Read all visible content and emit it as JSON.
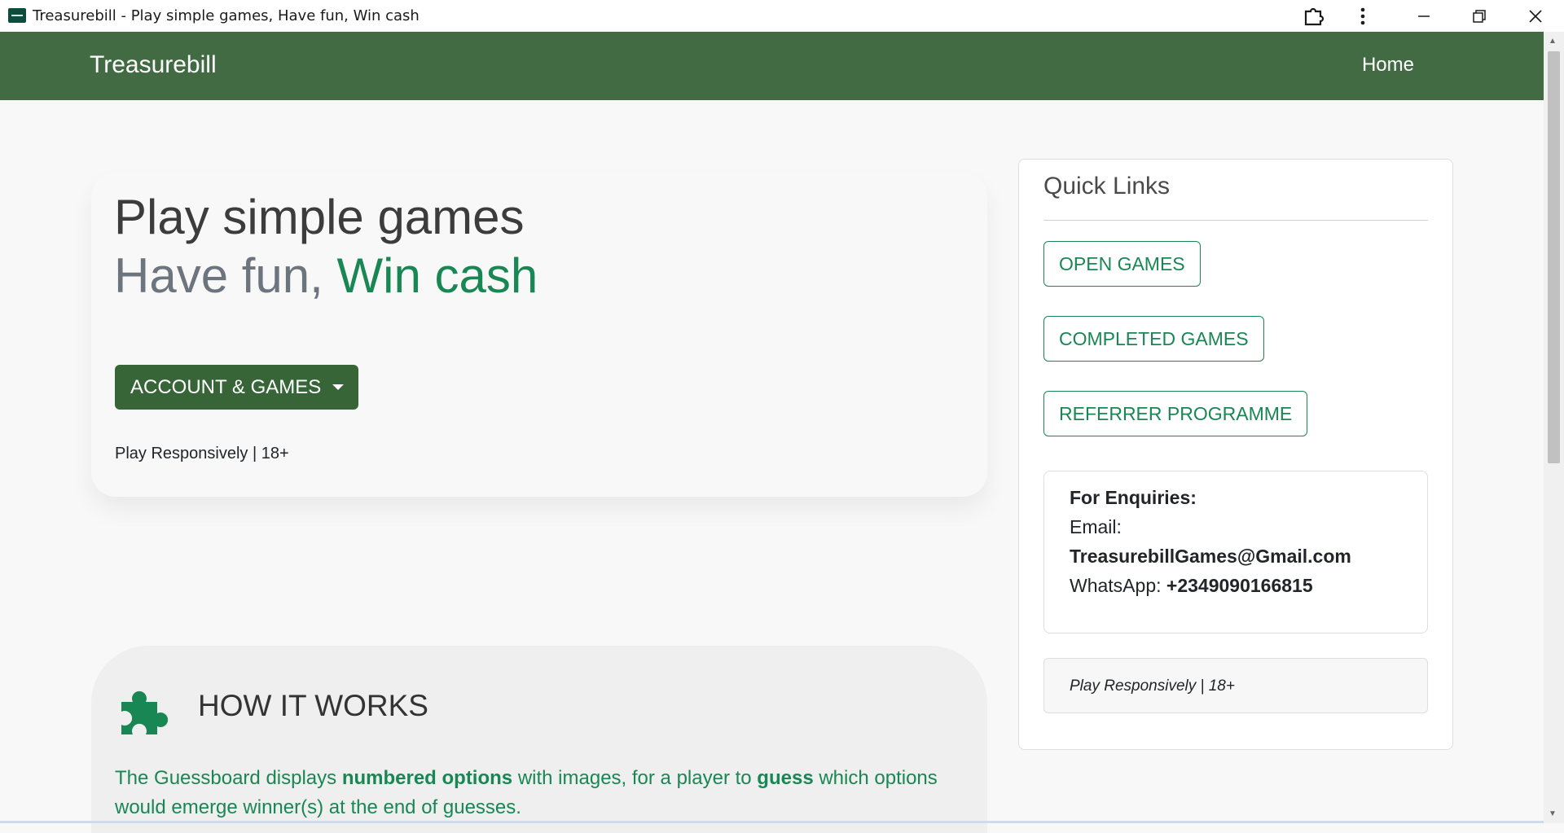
{
  "window": {
    "title": "Treasurebill - Play simple games, Have fun, Win cash",
    "controls": [
      "extensions-icon",
      "more-icon",
      "minimize-icon",
      "restore-icon",
      "close-icon"
    ]
  },
  "navbar": {
    "brand": "Treasurebill",
    "home_link": "Home"
  },
  "hero": {
    "line1": "Play simple games",
    "line2_prefix": "Have fun, ",
    "line2_accent": "Win cash",
    "account_button": "ACCOUNT & GAMES",
    "note": "Play Responsively | 18+"
  },
  "how_it_works": {
    "icon": "puzzle-icon",
    "title": "HOW IT WORKS",
    "text_1": "The Guessboard displays ",
    "text_bold_1": "numbered options",
    "text_2": " with images, for a player to ",
    "text_bold_2": "guess",
    "text_3": " which options would emerge winner(s) at the end of guesses."
  },
  "quick_links": {
    "title": "Quick Links",
    "buttons": [
      "OPEN GAMES",
      "COMPLETED GAMES",
      "REFERRER PROGRAMME"
    ],
    "enquiries": {
      "heading": "For Enquiries:",
      "email_label": "Email:",
      "email": "TreasurebillGames@Gmail.com",
      "whatsapp_label": "WhatsApp: ",
      "whatsapp": "+2349090166815"
    },
    "responsible_note": "Play Responsively | 18+"
  },
  "colors": {
    "navbar": "#426b43",
    "primary_button": "#376538",
    "accent_green": "#198754"
  }
}
